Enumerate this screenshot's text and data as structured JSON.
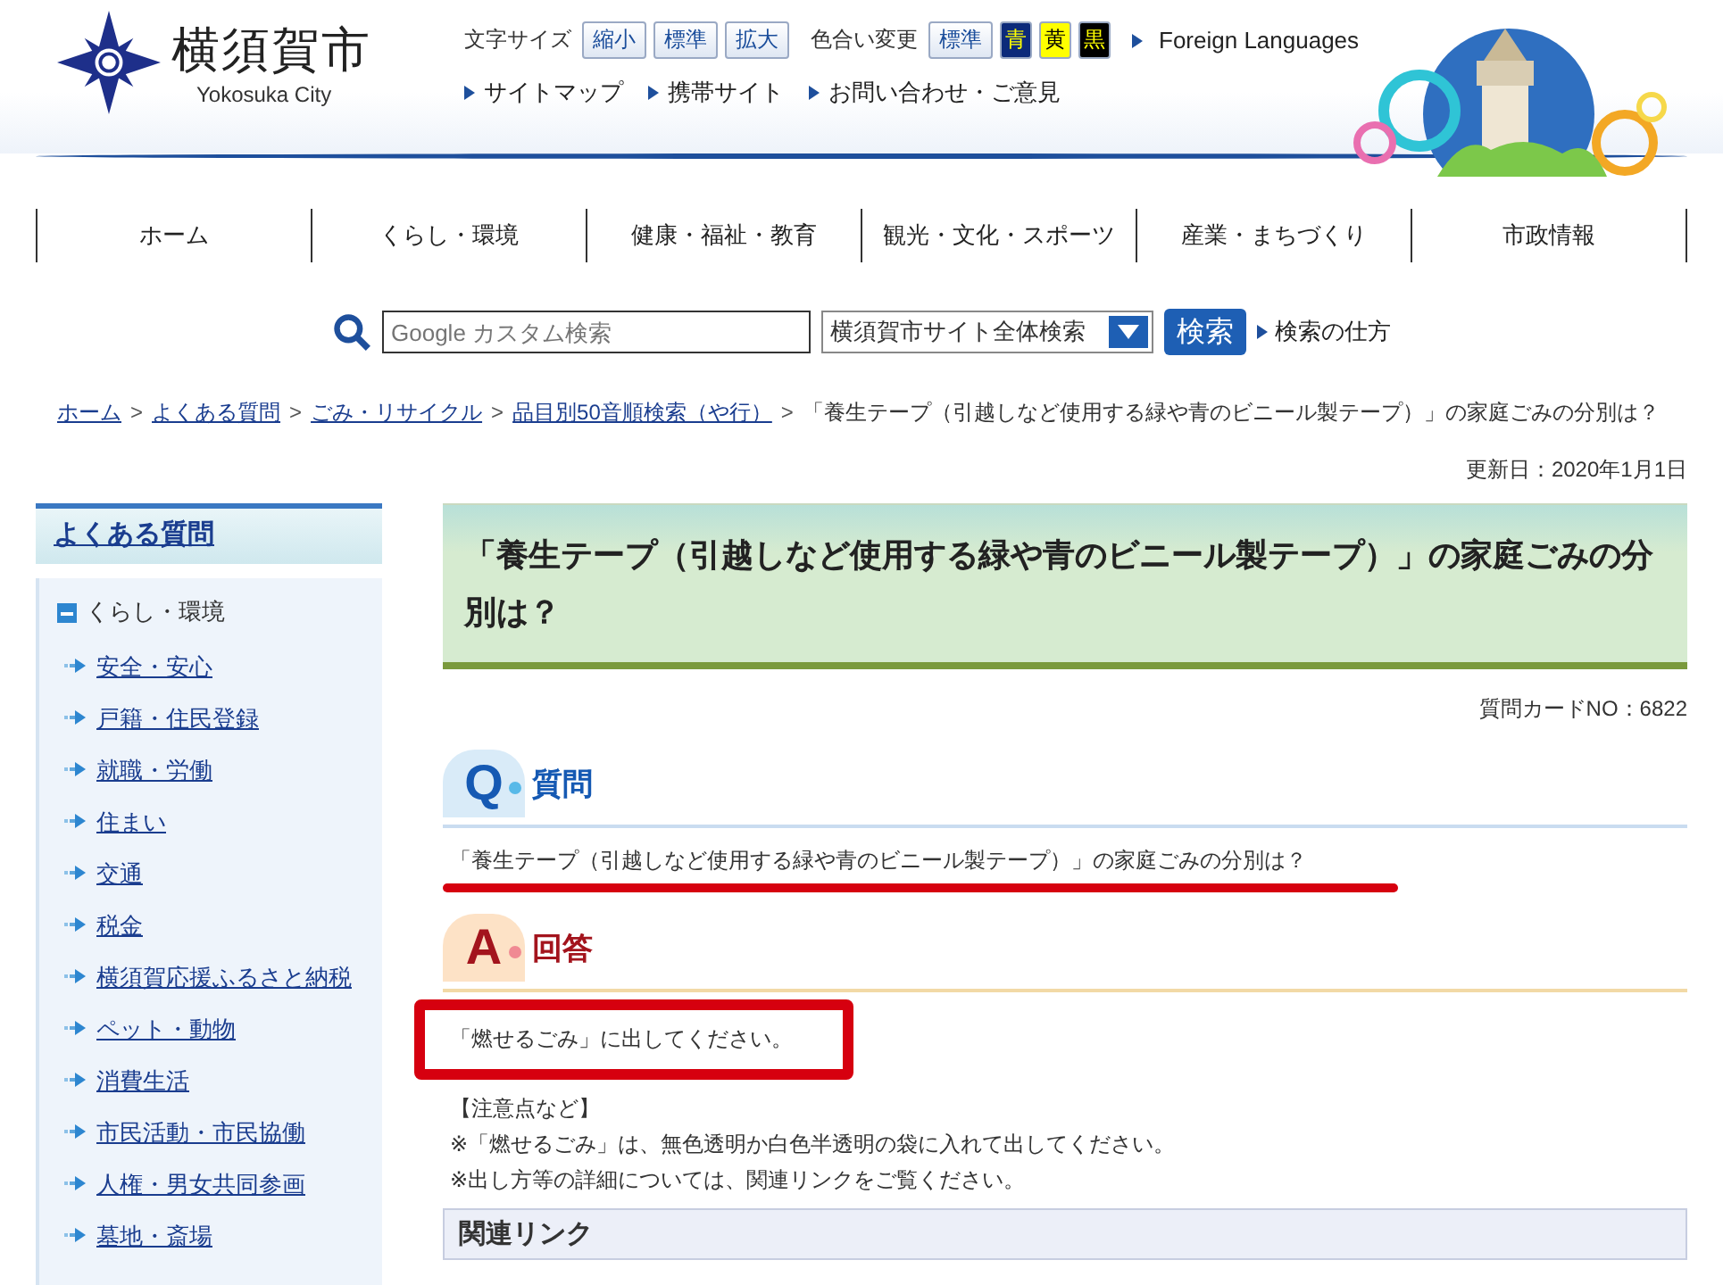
{
  "header": {
    "logo_title": "横須賀市",
    "logo_subtitle": "Yokosuka City",
    "text_size_label": "文字サイズ",
    "text_size_buttons": [
      "縮小",
      "標準",
      "拡大"
    ],
    "color_label": "色合い変更",
    "color_buttons": [
      {
        "label": "標準",
        "kind": "standard"
      },
      {
        "label": "青",
        "kind": "blue"
      },
      {
        "label": "黄",
        "kind": "yellow"
      },
      {
        "label": "黒",
        "kind": "black"
      }
    ],
    "foreign_link": "Foreign Languages",
    "util_links": [
      "サイトマップ",
      "携帯サイト",
      "お問い合わせ・ご意見"
    ]
  },
  "nav": [
    "ホーム",
    "くらし・環境",
    "健康・福祉・教育",
    "観光・文化・スポーツ",
    "産業・まちづくり",
    "市政情報"
  ],
  "search": {
    "placeholder": "Google カスタム検索",
    "scope": "横須賀市サイト全体検索",
    "button": "検索",
    "help_link": "検索の仕方"
  },
  "breadcrumb": {
    "separator": ">",
    "links": [
      "ホーム",
      "よくある質問",
      "ごみ・リサイクル",
      "品目別50音順検索（や行）"
    ],
    "current": "「養生テープ（引越しなど使用する緑や青のビニール製テープ）」の家庭ごみの分別は？"
  },
  "updated": "更新日：2020年1月1日",
  "sidebar": {
    "title": "よくある質問",
    "category": {
      "label": "くらし・環境",
      "expanded": true
    },
    "items": [
      "安全・安心",
      "戸籍・住民登録",
      "就職・労働",
      "住まい",
      "交通",
      "税金",
      "横須賀応援ふるさと納税",
      "ペット・動物",
      "消費生活",
      "市民活動・市民協働",
      "人権・男女共同参画",
      "墓地・斎場"
    ]
  },
  "main": {
    "title": "「養生テープ（引越しなど使用する緑や青のビニール製テープ）」の家庭ごみの分別は？",
    "card_no": "質問カードNO：6822",
    "question": {
      "mark": "Q",
      "heading": "質問",
      "text": "「養生テープ（引越しなど使用する緑や青のビニール製テープ）」の家庭ごみの分別は？"
    },
    "answer": {
      "mark": "A",
      "heading": "回答",
      "text": "「燃せるごみ」に出してください。"
    },
    "notes": [
      "【注意点など】",
      "※「燃せるごみ」は、無色透明か白色半透明の袋に入れて出してください。",
      "※出し方等の詳細については、関連リンクをご覧ください。"
    ],
    "related_heading": "関連リンク"
  }
}
